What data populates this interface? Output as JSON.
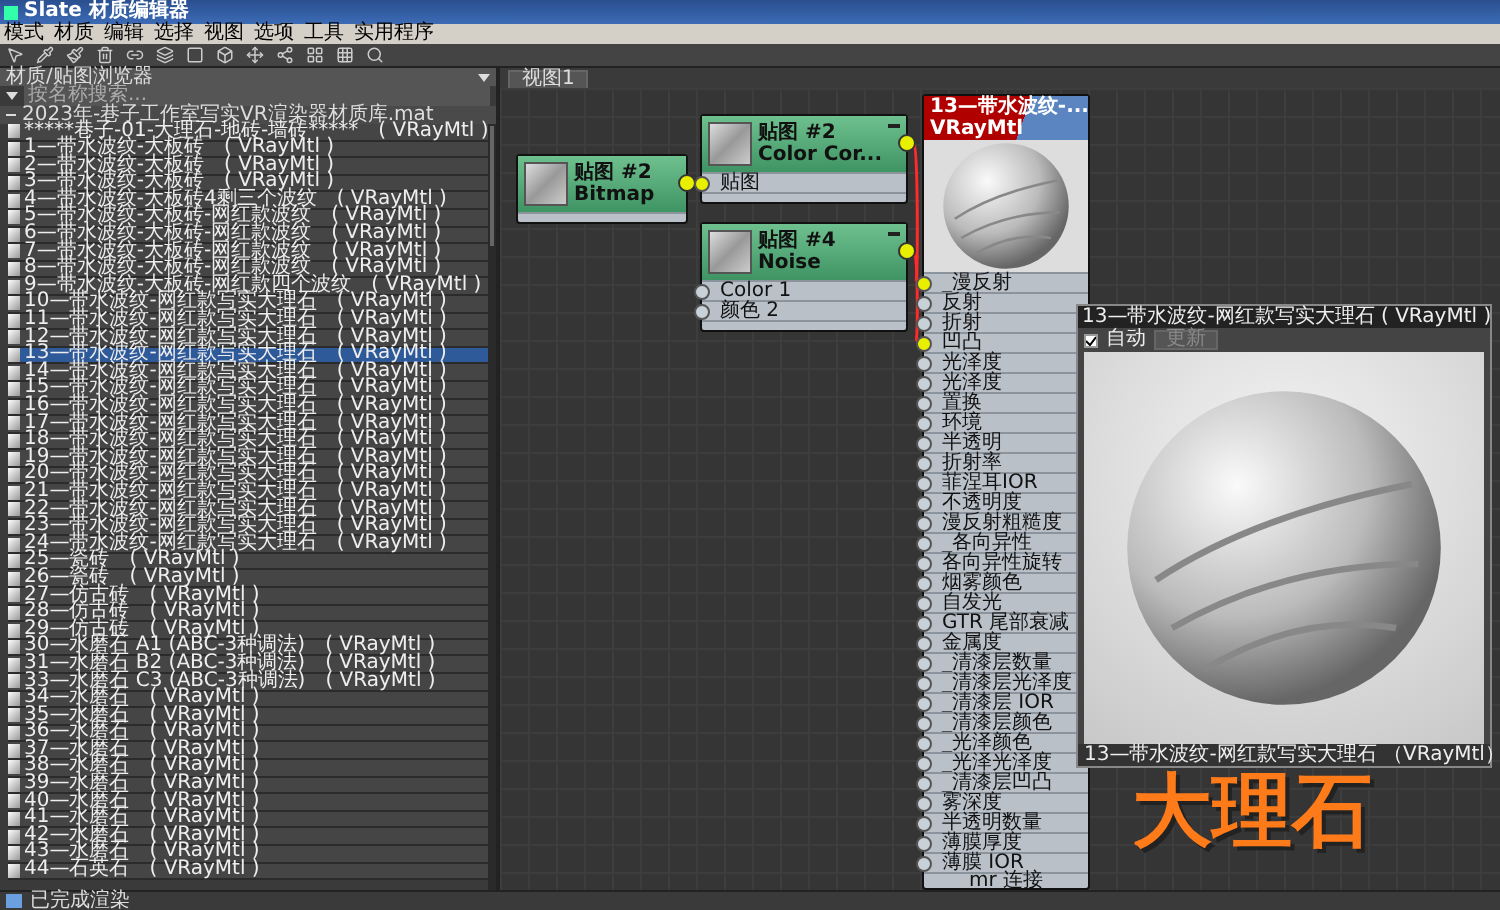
{
  "window": {
    "title": "Slate 材质编辑器"
  },
  "menu": [
    "模式",
    "材质",
    "编辑",
    "选择",
    "视图",
    "选项",
    "工具",
    "实用程序"
  ],
  "browser": {
    "title": "材质/贴图浏览器",
    "search": {
      "placeholder": "按名称搜索..."
    },
    "library": {
      "name": "2023年-巷子工作室写实VR渲染器材质库.mat",
      "expanded": true,
      "items": [
        {
          "name": "*****巷子-01-大理石-地砖-墙砖*****",
          "type": "( VRayMtl )",
          "selected": false
        },
        {
          "name": "1—带水波纹-大板砖",
          "type": "( VRayMtl )",
          "selected": false
        },
        {
          "name": "2—带水波纹-大板砖",
          "type": "( VRayMtl )",
          "selected": false
        },
        {
          "name": "3—带水波纹-大板砖",
          "type": "( VRayMtl )",
          "selected": false
        },
        {
          "name": "4—带水波纹-大板砖4剩三个波纹",
          "type": "( VRayMtl )",
          "selected": false
        },
        {
          "name": "5—带水波纹-大板砖-网红款波纹",
          "type": "( VRayMtl )",
          "selected": false
        },
        {
          "name": "6—带水波纹-大板砖-网红款波纹",
          "type": "( VRayMtl )",
          "selected": false
        },
        {
          "name": "7—带水波纹-大板砖-网红款波纹",
          "type": "( VRayMtl )",
          "selected": false
        },
        {
          "name": "8—带水波纹-大板砖-网红款波纹",
          "type": "( VRayMtl )",
          "selected": false
        },
        {
          "name": "9—带水波纹-大板砖-网红款四个波纹",
          "type": "( VRayMtl )",
          "selected": false
        },
        {
          "name": "10—带水波纹-网红款写实大理石",
          "type": "( VRayMtl )",
          "selected": false
        },
        {
          "name": "11—带水波纹-网红款写实大理石",
          "type": "( VRayMtl )",
          "selected": false
        },
        {
          "name": "12—带水波纹-网红款写实大理石",
          "type": "( VRayMtl )",
          "selected": false
        },
        {
          "name": "13—带水波纹-网红款写实大理石",
          "type": "( VRayMtl )",
          "selected": true
        },
        {
          "name": "14—带水波纹-网红款写实大理石",
          "type": "( VRayMtl )",
          "selected": false
        },
        {
          "name": "15—带水波纹-网红款写实大理石",
          "type": "( VRayMtl )",
          "selected": false
        },
        {
          "name": "16—带水波纹-网红款写实大理石",
          "type": "( VRayMtl )",
          "selected": false
        },
        {
          "name": "17—带水波纹-网红款写实大理石",
          "type": "( VRayMtl )",
          "selected": false
        },
        {
          "name": "18—带水波纹-网红款写实大理石",
          "type": "( VRayMtl )",
          "selected": false
        },
        {
          "name": "19—带水波纹-网红款写实大理石",
          "type": "( VRayMtl )",
          "selected": false
        },
        {
          "name": "20—带水波纹-网红款写实大理石",
          "type": "( VRayMtl )",
          "selected": false
        },
        {
          "name": "21—带水波纹-网红款写实大理石",
          "type": "( VRayMtl )",
          "selected": false
        },
        {
          "name": "22—带水波纹-网红款写实大理石",
          "type": "( VRayMtl )",
          "selected": false
        },
        {
          "name": "23—带水波纹-网红款写实大理石",
          "type": "( VRayMtl )",
          "selected": false
        },
        {
          "name": "24—带水波纹-网红款写实大理石",
          "type": "( VRayMtl )",
          "selected": false
        },
        {
          "name": "25—瓷砖",
          "type": "( VRayMtl )",
          "selected": false
        },
        {
          "name": "26—瓷砖",
          "type": "( VRayMtl )",
          "selected": false
        },
        {
          "name": "27—仿古砖",
          "type": "( VRayMtl )",
          "selected": false
        },
        {
          "name": "28—仿古砖",
          "type": "( VRayMtl )",
          "selected": false
        },
        {
          "name": "29—仿古砖",
          "type": "( VRayMtl )",
          "selected": false
        },
        {
          "name": "30—水磨石 A1 (ABC-3种调法)",
          "type": "( VRayMtl )",
          "selected": false
        },
        {
          "name": "31—水磨石 B2 (ABC-3种调法)",
          "type": "( VRayMtl )",
          "selected": false
        },
        {
          "name": "33—水磨石 C3 (ABC-3种调法)",
          "type": "( VRayMtl )",
          "selected": false
        },
        {
          "name": "34—水磨石",
          "type": "( VRayMtl )",
          "selected": false
        },
        {
          "name": "35—水磨石",
          "type": "( VRayMtl )",
          "selected": false
        },
        {
          "name": "36—水磨石",
          "type": "( VRayMtl )",
          "selected": false
        },
        {
          "name": "37—水磨石",
          "type": "( VRayMtl )",
          "selected": false
        },
        {
          "name": "38—水磨石",
          "type": "( VRayMtl )",
          "selected": false
        },
        {
          "name": "39—水磨石",
          "type": "( VRayMtl )",
          "selected": false
        },
        {
          "name": "40—水磨石",
          "type": "( VRayMtl )",
          "selected": false
        },
        {
          "name": "41—水磨石",
          "type": "( VRayMtl )",
          "selected": false
        },
        {
          "name": "42—水磨石",
          "type": "( VRayMtl )",
          "selected": false
        },
        {
          "name": "43—水磨石",
          "type": "( VRayMtl )",
          "selected": false
        },
        {
          "name": "44—石英石",
          "type": "( VRayMtl )",
          "selected": false
        }
      ]
    }
  },
  "view": {
    "tabs": [
      {
        "label": "视图1",
        "selected": true
      }
    ],
    "nodes": [
      {
        "kind": "map",
        "title": "贴图 #2",
        "subtitle": "Bitmap",
        "output_connected": true
      },
      {
        "kind": "map",
        "title": "贴图 #2",
        "subtitle": "Color Cor...",
        "output_connected": true,
        "slots": [
          {
            "label": "贴图",
            "connected": true
          }
        ]
      },
      {
        "kind": "map",
        "title": "贴图 #4",
        "subtitle": "Noise",
        "output_connected": true,
        "slots": [
          {
            "label": "Color 1",
            "connected": false
          },
          {
            "label": "颜色 2",
            "connected": false
          }
        ]
      },
      {
        "kind": "material",
        "title": "13—带水波纹-...",
        "subtitle": "VRayMtl",
        "footer": "mr 连接",
        "slots": [
          {
            "label": "_漫反射",
            "connected": true
          },
          {
            "label": "反射",
            "connected": false
          },
          {
            "label": "折射",
            "connected": false
          },
          {
            "label": "凹凸",
            "connected": true
          },
          {
            "label": "光泽度",
            "connected": false
          },
          {
            "label": "光泽度",
            "connected": false
          },
          {
            "label": "置换",
            "connected": false
          },
          {
            "label": "环境",
            "connected": false
          },
          {
            "label": "半透明",
            "connected": false
          },
          {
            "label": "折射率",
            "connected": false
          },
          {
            "label": "菲涅耳IOR",
            "connected": false
          },
          {
            "label": "不透明度",
            "connected": false
          },
          {
            "label": "漫反射粗糙度",
            "connected": false
          },
          {
            "label": "_各向异性",
            "connected": false
          },
          {
            "label": "各向异性旋转",
            "connected": false
          },
          {
            "label": "烟雾颜色",
            "connected": false
          },
          {
            "label": "自发光",
            "connected": false
          },
          {
            "label": "GTR 尾部衰减",
            "connected": false
          },
          {
            "label": "金属度",
            "connected": false
          },
          {
            "label": "_清漆层数量",
            "connected": false
          },
          {
            "label": "_清漆层光泽度",
            "connected": false
          },
          {
            "label": "_清漆层 IOR",
            "connected": false
          },
          {
            "label": "_清漆层颜色",
            "connected": false
          },
          {
            "label": "_光泽颜色",
            "connected": false
          },
          {
            "label": "_光泽光泽度",
            "connected": false
          },
          {
            "label": "_清漆层凹凸",
            "connected": false
          },
          {
            "label": "雾深度",
            "connected": false
          },
          {
            "label": "半透明数量",
            "connected": false
          },
          {
            "label": "薄膜厚度",
            "connected": false
          },
          {
            "label": "薄膜 IOR",
            "connected": false
          }
        ]
      }
    ],
    "preview": {
      "title": "13—带水波纹-网红款写实大理石 ( VRayMtl )",
      "auto": {
        "label": "自动",
        "checked": true
      },
      "update_button": {
        "label": "更新",
        "disabled": true
      },
      "footer": "13—带水波纹-网红款写实大理石 （VRayMtl）"
    }
  },
  "caption": "大理石",
  "status_bar": "已完成渲染"
}
